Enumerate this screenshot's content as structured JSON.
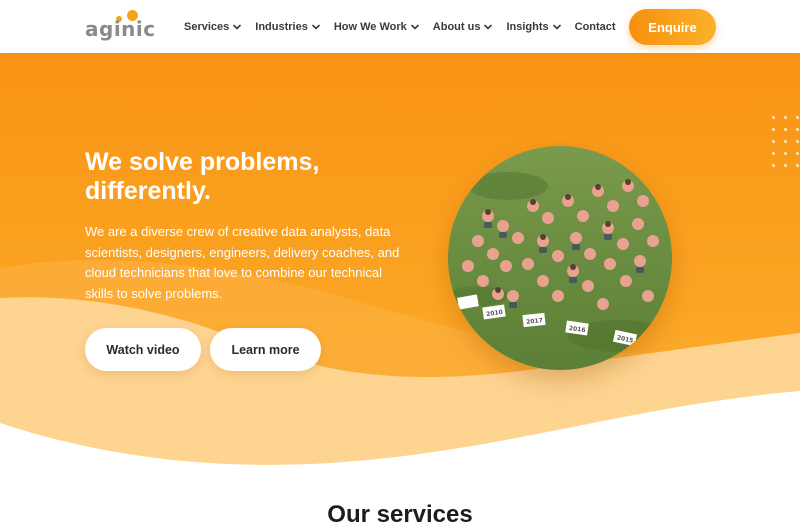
{
  "brand": {
    "logo_text": "aginic",
    "accent": "#f7a21b"
  },
  "nav": {
    "items": [
      {
        "label": "Services",
        "has_dropdown": true
      },
      {
        "label": "Industries",
        "has_dropdown": true
      },
      {
        "label": "How We Work",
        "has_dropdown": true
      },
      {
        "label": "About us",
        "has_dropdown": true
      },
      {
        "label": "Insights",
        "has_dropdown": true
      },
      {
        "label": "Contact",
        "has_dropdown": false
      }
    ],
    "cta_label": "Enquire"
  },
  "hero": {
    "title_line1": "We solve problems,",
    "title_line2": "differently.",
    "description": "We are a diverse crew of creative data analysts, data scientists, designers, engineers, delivery coaches, and cloud technicians that love to combine our technical skills to solve problems.",
    "watch_label": "Watch video",
    "learn_label": "Learn more",
    "photo": {
      "sign_labels": [
        "2010",
        "2017",
        "2016",
        "2015",
        "2018"
      ]
    }
  },
  "services": {
    "heading": "Our services"
  },
  "colors": {
    "hero_orange": "#f99414",
    "hero_light": "#fcb23a",
    "wave_pale": "#fde0b0",
    "text_white": "#ffffff"
  }
}
